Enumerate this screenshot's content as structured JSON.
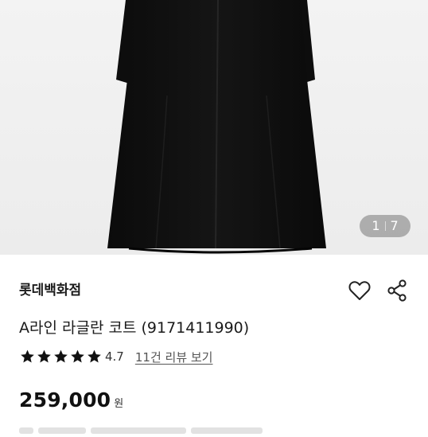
{
  "gallery": {
    "current": "1",
    "total": "7",
    "image_icon": "coat-image"
  },
  "product": {
    "brand": "롯데백화점",
    "title": "A라인 라글란 코트 (9171411990)",
    "rating": 4.7,
    "rating_label": "4.7",
    "reviews_link": "11건 리뷰 보기",
    "price": "259,000",
    "currency": "원"
  },
  "actions": {
    "like_icon": "heart-icon",
    "share_icon": "share-icon"
  },
  "colors": {
    "star": "#111111",
    "price": "#111111"
  }
}
